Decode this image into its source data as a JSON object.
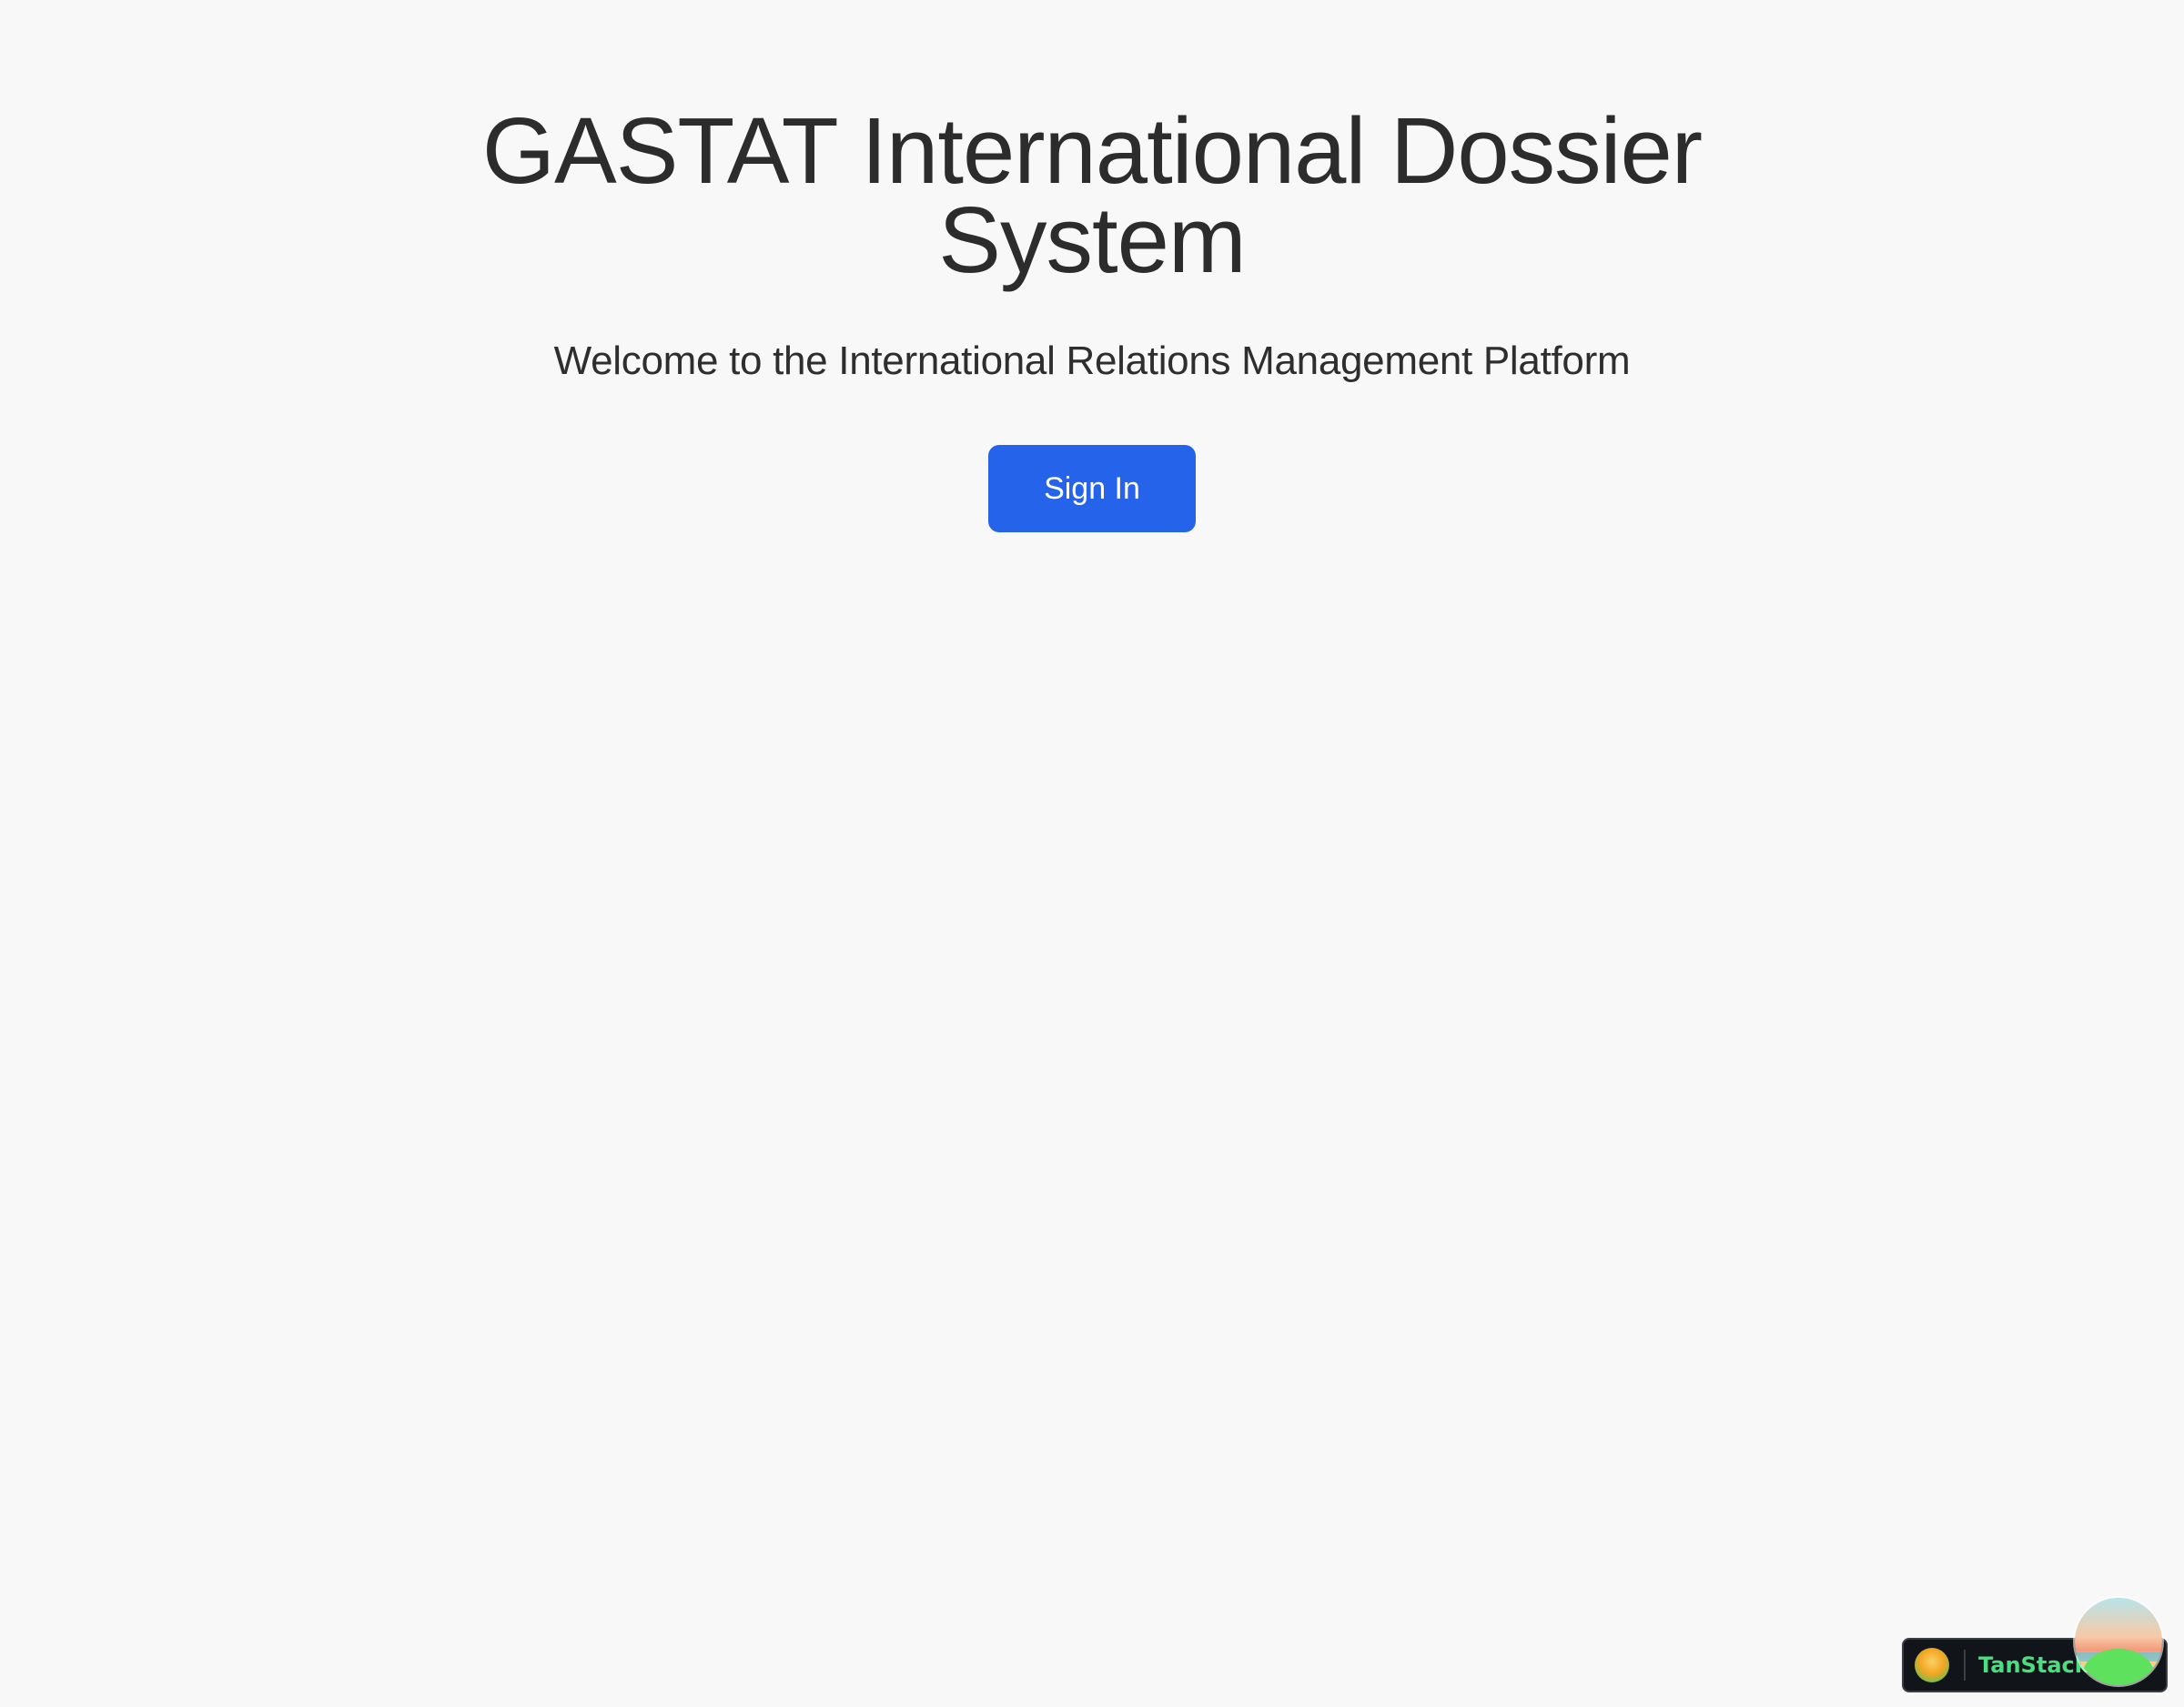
{
  "hero": {
    "title": "GASTAT International Dossier System",
    "subtitle": "Welcome to the International Relations Management Platform",
    "signin_label": "Sign In"
  },
  "devtools": {
    "label": "TanStack",
    "logo_icon": "tanstack-logo-icon",
    "orb_icon": "tanstack-devtools-orb-icon"
  },
  "colors": {
    "background": "#f8f8f8",
    "primary_button": "#2563eb",
    "text": "#2b2b2b",
    "devtools_text": "#4ade80"
  }
}
